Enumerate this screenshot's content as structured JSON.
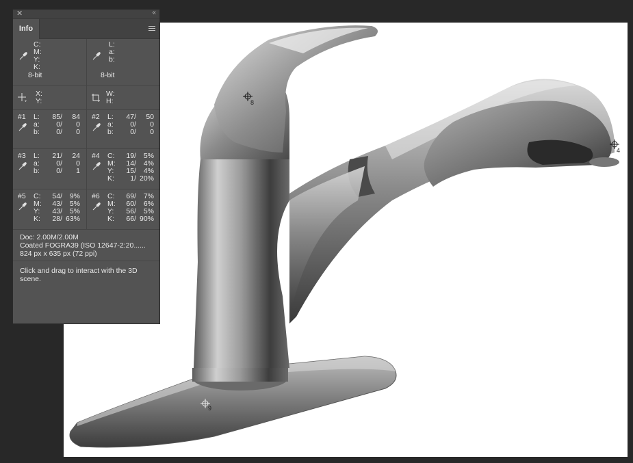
{
  "window": {
    "close_glyph": "✕",
    "collapse_glyph": "‹‹"
  },
  "panel": {
    "tab_label": "Info",
    "menu_icon": "panel-menu-icon",
    "top_left": {
      "labels": [
        "C:",
        "M:",
        "Y:",
        "K:"
      ],
      "bit_depth": "8-bit"
    },
    "top_right": {
      "labels": [
        "L:",
        "a:",
        "b:"
      ],
      "bit_depth": "8-bit"
    },
    "position": {
      "labels": [
        "X:",
        "Y:"
      ]
    },
    "size": {
      "labels": [
        "W:",
        "H:"
      ]
    },
    "samplers": [
      {
        "id": "#1",
        "mode": "lab",
        "rows": [
          {
            "l": "L:",
            "a": "85/",
            "b": "84"
          },
          {
            "l": "a:",
            "a": "0/",
            "b": "0"
          },
          {
            "l": "b:",
            "a": "0/",
            "b": "0"
          }
        ]
      },
      {
        "id": "#2",
        "mode": "lab",
        "rows": [
          {
            "l": "L:",
            "a": "47/",
            "b": "50"
          },
          {
            "l": "a:",
            "a": "0/",
            "b": "0"
          },
          {
            "l": "b:",
            "a": "0/",
            "b": "0"
          }
        ]
      },
      {
        "id": "#3",
        "mode": "lab",
        "rows": [
          {
            "l": "L:",
            "a": "21/",
            "b": "24"
          },
          {
            "l": "a:",
            "a": "0/",
            "b": "0"
          },
          {
            "l": "b:",
            "a": "0/",
            "b": "1"
          }
        ]
      },
      {
        "id": "#4",
        "mode": "cmyk",
        "rows": [
          {
            "l": "C:",
            "a": "19/",
            "b": "5%"
          },
          {
            "l": "M:",
            "a": "14/",
            "b": "4%"
          },
          {
            "l": "Y:",
            "a": "15/",
            "b": "4%"
          },
          {
            "l": "K:",
            "a": "1/",
            "b": "20%"
          }
        ]
      },
      {
        "id": "#5",
        "mode": "cmyk",
        "rows": [
          {
            "l": "C:",
            "a": "54/",
            "b": "9%"
          },
          {
            "l": "M:",
            "a": "43/",
            "b": "5%"
          },
          {
            "l": "Y:",
            "a": "43/",
            "b": "5%"
          },
          {
            "l": "K:",
            "a": "28/",
            "b": "63%"
          }
        ]
      },
      {
        "id": "#6",
        "mode": "cmyk",
        "rows": [
          {
            "l": "C:",
            "a": "69/",
            "b": "7%"
          },
          {
            "l": "M:",
            "a": "60/",
            "b": "6%"
          },
          {
            "l": "Y:",
            "a": "56/",
            "b": "5%"
          },
          {
            "l": "K:",
            "a": "66/",
            "b": "90%"
          }
        ]
      }
    ],
    "doc": {
      "size": "Doc: 2.00M/2.00M",
      "profile": "Coated FOGRA39 (ISO 12647-2:20......",
      "dimensions": "824 px x 635 px (72 ppi)"
    },
    "hint": "Click and drag to interact with the 3D scene."
  },
  "canvas": {
    "sampler_markers": [
      "8",
      "4",
      "9"
    ]
  },
  "colors": {
    "panel_bg": "#535353",
    "workspace_bg": "#282828",
    "tab_bar": "#424242"
  }
}
